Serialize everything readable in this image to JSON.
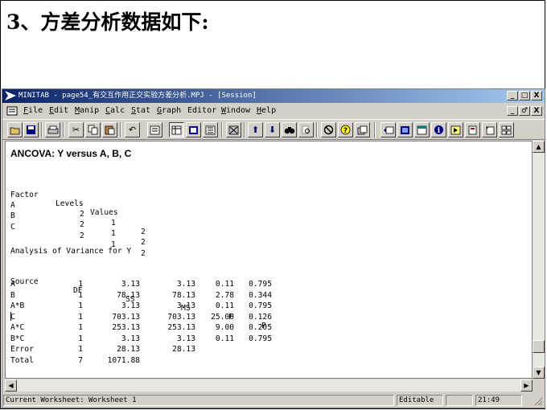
{
  "slide": {
    "title": "3、方差分析数据如下:"
  },
  "window": {
    "title": "MINITAB - page54_有交互作用正交实验方差分析.MPJ - [Session]",
    "controls": [
      "_",
      "□",
      "X"
    ],
    "mdi_controls": [
      "_",
      "♂",
      "X"
    ]
  },
  "menu": [
    {
      "key": "F",
      "rest": "ile"
    },
    {
      "key": "E",
      "rest": "dit"
    },
    {
      "key": "M",
      "rest": "anip"
    },
    {
      "key": "C",
      "rest": "alc"
    },
    {
      "key": "S",
      "rest": "tat"
    },
    {
      "key": "G",
      "rest": "raph"
    },
    {
      "key": "",
      "rest": "Editor"
    },
    {
      "key": "W",
      "rest": "indow"
    },
    {
      "key": "H",
      "rest": "elp"
    }
  ],
  "toolbar": {
    "icons": [
      "open-icon",
      "save-icon",
      "print-icon",
      "cut-icon",
      "copy-icon",
      "paste-icon",
      "undo-icon",
      "session-window-icon",
      "data-window-icon",
      "info-window-icon",
      "history-icon",
      "delete-icon",
      "up-arrow-icon",
      "down-arrow-icon",
      "find-icon",
      "replace-icon",
      "cancel-icon",
      "help-icon",
      "project-manager-icon",
      "graph-folder-icon",
      "worksheet-folder-icon",
      "graph-icon",
      "info-icon",
      "macro-icon",
      "report-icon",
      "new-worksheet-icon",
      "tile-icon"
    ]
  },
  "session": {
    "heading": "ANCOVA: Y versus A, B, C",
    "factor_table": {
      "headers": [
        "Factor",
        "Levels",
        "Values"
      ],
      "rows": [
        {
          "factor": "A",
          "levels": "2",
          "v1": "1",
          "v2": "2"
        },
        {
          "factor": "B",
          "levels": "2",
          "v1": "1",
          "v2": "2"
        },
        {
          "factor": "C",
          "levels": "2",
          "v1": "1",
          "v2": "2"
        }
      ]
    },
    "anova_title": "Analysis of Variance for Y",
    "anova_table": {
      "headers": [
        "Source",
        "DF",
        "SS",
        "MS",
        "F",
        "P"
      ],
      "rows": [
        {
          "source": "A",
          "df": "1",
          "ss": "3.13",
          "ms": "3.13",
          "f": "0.11",
          "p": "0.795"
        },
        {
          "source": "B",
          "df": "1",
          "ss": "78.13",
          "ms": "78.13",
          "f": "2.78",
          "p": "0.344"
        },
        {
          "source": "A*B",
          "df": "1",
          "ss": "3.13",
          "ms": "3.13",
          "f": "0.11",
          "p": "0.795"
        },
        {
          "source": "C",
          "df": "1",
          "ss": "703.13",
          "ms": "703.13",
          "f": "25.00",
          "p": "0.126"
        },
        {
          "source": "A*C",
          "df": "1",
          "ss": "253.13",
          "ms": "253.13",
          "f": "9.00",
          "p": "0.205"
        },
        {
          "source": "B*C",
          "df": "1",
          "ss": "3.13",
          "ms": "3.13",
          "f": "0.11",
          "p": "0.795"
        },
        {
          "source": "Error",
          "df": "1",
          "ss": "28.13",
          "ms": "28.13",
          "f": "",
          "p": ""
        },
        {
          "source": "Total",
          "df": "7",
          "ss": "1071.88",
          "ms": "",
          "f": "",
          "p": ""
        }
      ]
    }
  },
  "status": {
    "worksheet": "Current Worksheet: Worksheet 1",
    "mode": "Editable",
    "time": "21:49"
  }
}
